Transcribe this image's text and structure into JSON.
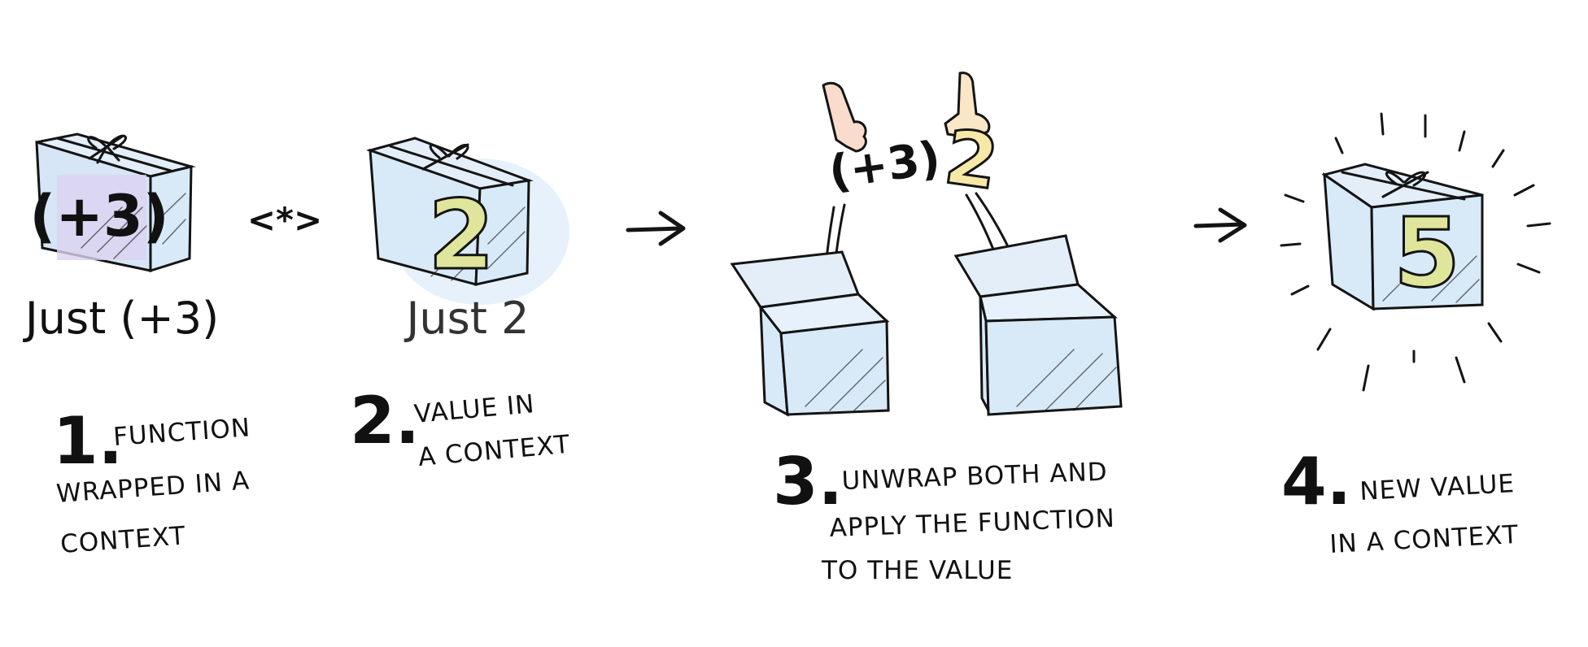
{
  "panels": [
    {
      "label": "Just (+3)",
      "box_content": "(+3)"
    },
    {
      "label": "Just 2",
      "box_content": "2"
    }
  ],
  "operator": "<*>",
  "steps": [
    {
      "number": "1.",
      "caption": [
        "FUNCTION",
        "WRAPPED IN A",
        "CONTEXT"
      ]
    },
    {
      "number": "2.",
      "caption": [
        "VALUE IN",
        "A CONTEXT"
      ]
    },
    {
      "number": "3.",
      "caption": [
        "UNWRAP BOTH AND",
        "APPLY THE FUNCTION",
        "TO THE VALUE"
      ]
    },
    {
      "number": "4.",
      "caption": [
        "NEW VALUE",
        "IN A CONTEXT"
      ]
    }
  ],
  "unwrapped": {
    "function": "(+3)",
    "value": "2"
  },
  "result": {
    "box_content": "5"
  },
  "colors": {
    "box_fill": "#d8eaf8",
    "box_glow": "#e6f1fb",
    "function_fill": "#dcd2f0",
    "number_fill": "#dfe59a",
    "number_fill_light": "#f6e9a8",
    "hand_left": "#f9dccb",
    "hand_right": "#fbe7c6",
    "ink": "#141414"
  }
}
